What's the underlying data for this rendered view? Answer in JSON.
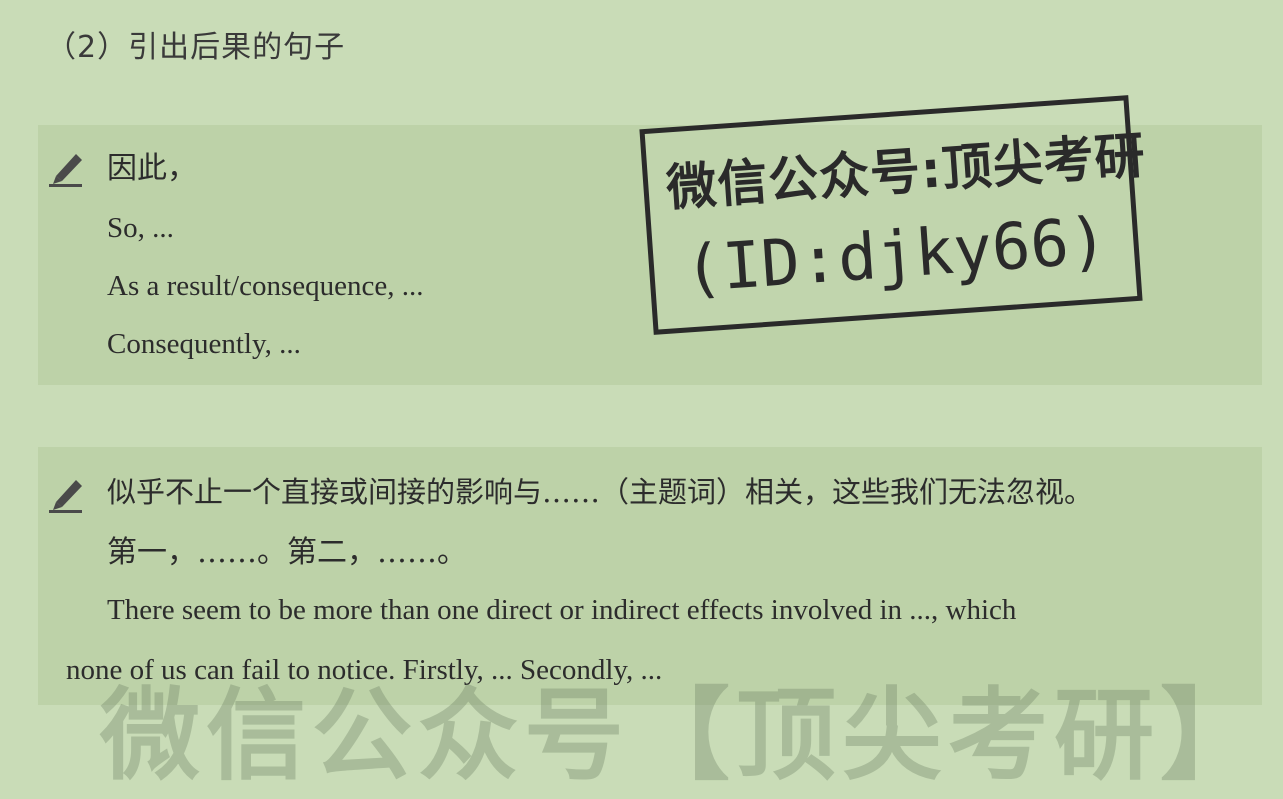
{
  "heading": "（2）引出后果的句子",
  "section1": {
    "icon": "pencil-icon",
    "chinese": "因此，",
    "lines": [
      "So, ...",
      "As a result/consequence, ...",
      "Consequently, ..."
    ]
  },
  "section2": {
    "icon": "pencil-icon",
    "chinese_line1": "似乎不止一个直接或间接的影响与……（主题词）相关，这些我们无法忽视。",
    "chinese_line2": "第一，……。第二，……。",
    "english_line1": "There seem to be more than one direct or indirect effects involved in ..., which",
    "english_line2": "none of us can fail to notice. Firstly, ... Secondly, ..."
  },
  "stamp": {
    "line1": "微信公众号:顶尖考研",
    "line2": "(ID:djky66)"
  },
  "watermark": "微信公众号【顶尖考研】"
}
